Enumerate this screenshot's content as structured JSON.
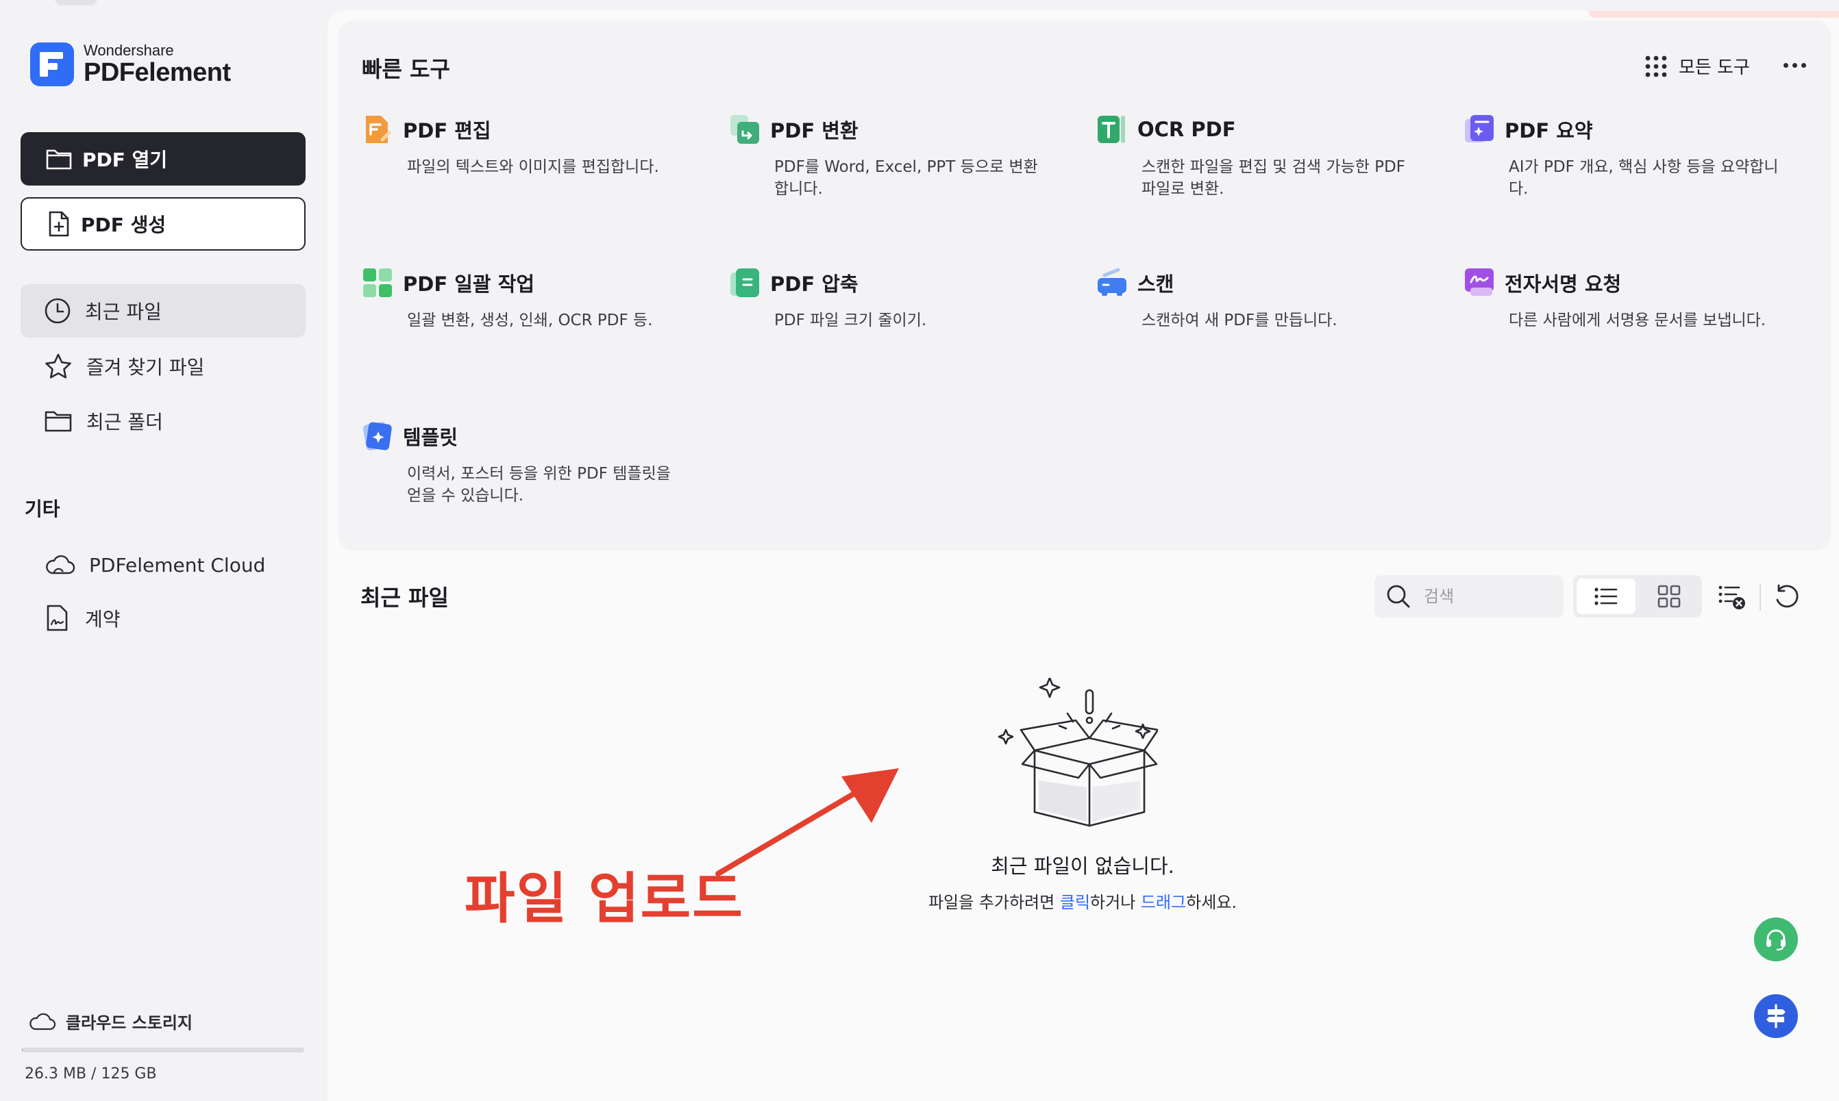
{
  "brand": {
    "top": "Wondershare",
    "main": "PDFelement"
  },
  "sidebar": {
    "open_label": "PDF 열기",
    "create_label": "PDF 생성",
    "nav": [
      {
        "label": "최근 파일"
      },
      {
        "label": "즐겨 찾기 파일"
      },
      {
        "label": "최근 폴더"
      }
    ],
    "other_section": "기타",
    "other": [
      {
        "label": "PDFelement Cloud"
      },
      {
        "label": "계약"
      }
    ],
    "storage": {
      "label": "클라우드 스토리지",
      "usage": "26.3 MB / 125 GB",
      "fraction": 0.0002
    }
  },
  "quick_tools": {
    "title": "빠른 도구",
    "all_tools": "모든 도구",
    "items": [
      {
        "name": "PDF 편집",
        "desc": "파일의 텍스트와 이미지를 편집합니다.",
        "icon": "edit-icon",
        "color": "#f29a3c"
      },
      {
        "name": "PDF 변환",
        "desc": "PDF를 Word, Excel, PPT 등으로 변환합니다.",
        "icon": "convert-icon",
        "color": "#3fae7a"
      },
      {
        "name": "OCR PDF",
        "desc": "스캔한 파일을 편집 및 검색 가능한 PDF 파일로 변환.",
        "icon": "ocr-icon",
        "color": "#2fa86a"
      },
      {
        "name": "PDF 요약",
        "desc": "AI가 PDF 개요, 핵심 사항 등을 요약합니다.",
        "icon": "summary-icon",
        "color": "#6b5cf0"
      },
      {
        "name": "PDF 일괄 작업",
        "desc": "일괄 변환, 생성, 인쇄, OCR PDF 등.",
        "icon": "batch-icon",
        "color": "#3fbf68"
      },
      {
        "name": "PDF 압축",
        "desc": "PDF 파일 크기 줄이기.",
        "icon": "compress-icon",
        "color": "#37b57c"
      },
      {
        "name": "스캔",
        "desc": "스캔하여 새 PDF를 만듭니다.",
        "icon": "scan-icon",
        "color": "#3f7ef0"
      },
      {
        "name": "전자서명 요청",
        "desc": "다른 사람에게 서명용 문서를 보냅니다.",
        "icon": "esign-icon",
        "color": "#a24fe6"
      },
      {
        "name": "템플릿",
        "desc": "이력서, 포스터 등을 위한 PDF 템플릿을 얻을 수 있습니다.",
        "icon": "template-icon",
        "color": "#3a6ff0"
      }
    ]
  },
  "recent": {
    "title": "최근 파일",
    "search_placeholder": "검색",
    "empty_title": "최근 파일이 없습니다.",
    "empty_sub_1": "파일을 추가하려면 ",
    "empty_link_click": "클릭",
    "empty_sub_2": "하거나 ",
    "empty_link_drag": "드래그",
    "empty_sub_3": "하세요."
  },
  "annotation": {
    "text": "파일 업로드",
    "color": "#e3402f"
  },
  "colors": {
    "accent": "#2f6df6",
    "dark_button": "#25252d",
    "support": "#3fba70"
  }
}
